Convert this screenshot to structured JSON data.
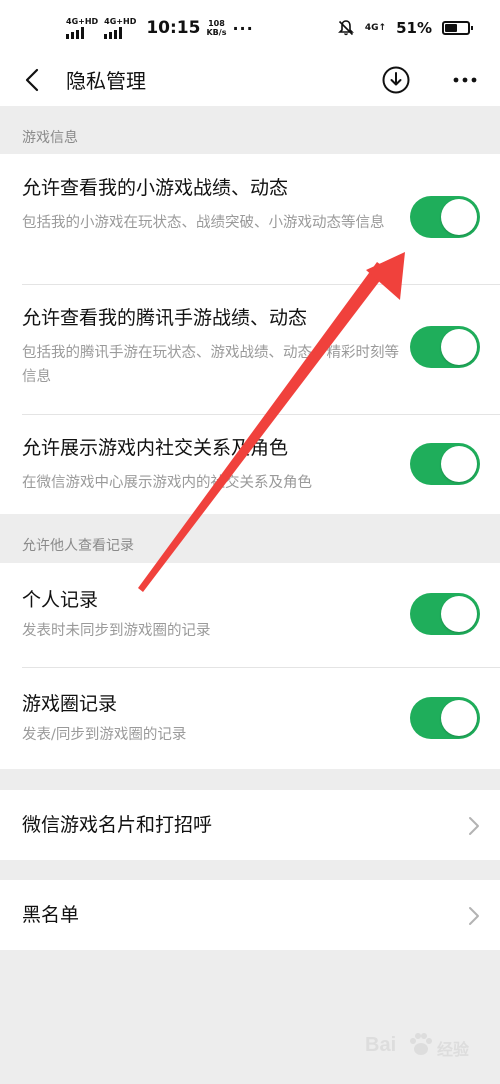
{
  "status_bar": {
    "sim1": "4G+HD",
    "sim2": "4G+HD",
    "time": "10:15",
    "speed_value": "108",
    "speed_unit": "KB/s",
    "dots": "···",
    "network": "4G↑",
    "battery_percent": "51%"
  },
  "nav": {
    "title": "隐私管理"
  },
  "sections": [
    {
      "header": "游戏信息"
    },
    {
      "header": "允许他人查看记录"
    }
  ],
  "game_info_items": [
    {
      "title": "允许查看我的小游戏战绩、动态",
      "desc": "包括我的小游戏在玩状态、战绩突破、小游戏动态等信息",
      "enabled": true
    },
    {
      "title": "允许查看我的腾讯手游战绩、动态",
      "desc": "包括我的腾讯手游在玩状态、游戏战绩、动态、精彩时刻等信息",
      "enabled": true
    },
    {
      "title": "允许展示游戏内社交关系及角色",
      "desc": "在微信游戏中心展示游戏内的社交关系及角色",
      "enabled": true
    }
  ],
  "record_items": [
    {
      "title": "个人记录",
      "desc": "发表时未同步到游戏圈的记录",
      "enabled": true
    },
    {
      "title": "游戏圈记录",
      "desc": "发表/同步到游戏圈的记录",
      "enabled": true
    }
  ],
  "links": [
    {
      "label": "微信游戏名片和打招呼",
      "chevron": ">"
    },
    {
      "label": "黑名单",
      "chevron": ">"
    }
  ],
  "watermark": {
    "text_left": "Bai",
    "text_right": "经验"
  },
  "colors": {
    "toggle_on": "#1fae5b",
    "annotation_arrow": "#f0413c",
    "background": "#ededed"
  }
}
